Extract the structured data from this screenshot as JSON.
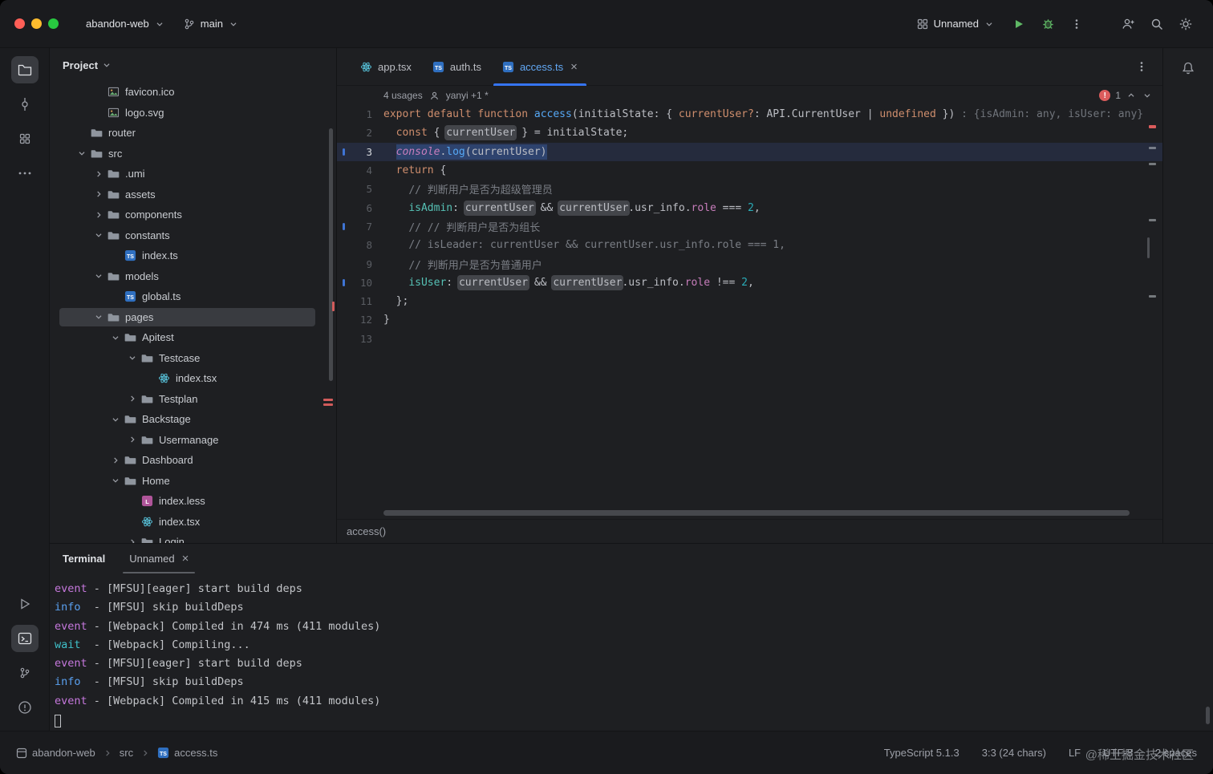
{
  "titlebar": {
    "project": "abandon-web",
    "branch": "main",
    "run_config": "Unnamed",
    "actions": [
      {
        "id": "run",
        "icon": "play"
      },
      {
        "id": "debug",
        "icon": "bug"
      },
      {
        "id": "more",
        "icon": "kebab"
      }
    ],
    "tools": [
      {
        "id": "add-user",
        "icon": "person-plus"
      },
      {
        "id": "search",
        "icon": "search"
      },
      {
        "id": "settings",
        "icon": "gear"
      }
    ]
  },
  "left_rail": {
    "top": [
      {
        "id": "project",
        "icon": "folder-outline",
        "active": true
      },
      {
        "id": "commit",
        "icon": "commit",
        "active": false
      },
      {
        "id": "structure",
        "icon": "grid",
        "active": false
      },
      {
        "id": "more",
        "icon": "more-dots",
        "active": false
      }
    ],
    "bottom": [
      {
        "id": "run",
        "icon": "run-outline",
        "active": false
      },
      {
        "id": "terminal",
        "icon": "terminal",
        "active": true
      },
      {
        "id": "version-control",
        "icon": "branch",
        "active": false
      },
      {
        "id": "problems",
        "icon": "problems",
        "active": false
      }
    ]
  },
  "project_panel": {
    "title": "Project",
    "tree": [
      {
        "label": "favicon.ico",
        "depth": 2,
        "icon": "image"
      },
      {
        "label": "logo.svg",
        "depth": 2,
        "icon": "image"
      },
      {
        "label": "router",
        "depth": 1,
        "icon": "folder"
      },
      {
        "label": "src",
        "depth": 1,
        "icon": "folder",
        "chevron": "down"
      },
      {
        "label": ".umi",
        "depth": 2,
        "icon": "folder",
        "chevron": "right"
      },
      {
        "label": "assets",
        "depth": 2,
        "icon": "folder",
        "chevron": "right"
      },
      {
        "label": "components",
        "depth": 2,
        "icon": "folder",
        "chevron": "right"
      },
      {
        "label": "constants",
        "depth": 2,
        "icon": "folder",
        "chevron": "down"
      },
      {
        "label": "index.ts",
        "depth": 3,
        "icon": "ts"
      },
      {
        "label": "models",
        "depth": 2,
        "icon": "folder",
        "chevron": "down"
      },
      {
        "label": "global.ts",
        "depth": 3,
        "icon": "ts"
      },
      {
        "label": "pages",
        "depth": 2,
        "icon": "folder",
        "chevron": "down",
        "selected": true
      },
      {
        "label": "Apitest",
        "depth": 3,
        "icon": "folder",
        "chevron": "down"
      },
      {
        "label": "Testcase",
        "depth": 4,
        "icon": "folder",
        "chevron": "down"
      },
      {
        "label": "index.tsx",
        "depth": 5,
        "icon": "tsx"
      },
      {
        "label": "Testplan",
        "depth": 4,
        "icon": "folder",
        "chevron": "right"
      },
      {
        "label": "Backstage",
        "depth": 3,
        "icon": "folder",
        "chevron": "down"
      },
      {
        "label": "Usermanage",
        "depth": 4,
        "icon": "folder",
        "chevron": "right"
      },
      {
        "label": "Dashboard",
        "depth": 3,
        "icon": "folder",
        "chevron": "right"
      },
      {
        "label": "Home",
        "depth": 3,
        "icon": "folder",
        "chevron": "down"
      },
      {
        "label": "index.less",
        "depth": 4,
        "icon": "less"
      },
      {
        "label": "index.tsx",
        "depth": 4,
        "icon": "tsx"
      },
      {
        "label": "Login",
        "depth": 4,
        "icon": "folder",
        "chevron": "right"
      }
    ]
  },
  "editor": {
    "tabs": [
      {
        "label": "app.tsx",
        "icon": "tsx",
        "active": false,
        "closable": false
      },
      {
        "label": "auth.ts",
        "icon": "ts",
        "active": false,
        "closable": false
      },
      {
        "label": "access.ts",
        "icon": "ts",
        "active": true,
        "closable": true
      }
    ],
    "usages_label": "4 usages",
    "author": "yanyi +1 *",
    "error_badge": "1",
    "breadcrumb": "access()",
    "code": {
      "lines": [
        {
          "num": "1",
          "tokens": [
            {
              "t": "export",
              "c": "kw"
            },
            {
              "t": " "
            },
            {
              "t": "default",
              "c": "kw"
            },
            {
              "t": " "
            },
            {
              "t": "function",
              "c": "kw"
            },
            {
              "t": " "
            },
            {
              "t": "access",
              "c": "fn"
            },
            {
              "t": "(initialState: { "
            },
            {
              "t": "currentUser?",
              "c": "kw"
            },
            {
              "t": ": API.CurrentUser | "
            },
            {
              "t": "undefined",
              "c": "kw"
            },
            {
              "t": " }) "
            },
            {
              "t": ": {isAdmin: any, isUser: any}",
              "c": "hint"
            }
          ]
        },
        {
          "num": "2",
          "tokens": [
            {
              "t": "  "
            },
            {
              "t": "const",
              "c": "kw"
            },
            {
              "t": " { "
            },
            {
              "t": "currentUser",
              "hl": true
            },
            {
              "t": " } = initialState;"
            }
          ]
        },
        {
          "num": "3",
          "caret": true,
          "changed": true,
          "tokens": [
            {
              "t": "  "
            },
            {
              "t": "console",
              "c": "console",
              "sel": true
            },
            {
              "t": ".",
              "sel": true
            },
            {
              "t": "log",
              "c": "fn",
              "sel": true
            },
            {
              "t": "(currentUser)",
              "sel": true
            }
          ]
        },
        {
          "num": "4",
          "tokens": [
            {
              "t": "  "
            },
            {
              "t": "return",
              "c": "kw"
            },
            {
              "t": " {"
            }
          ]
        },
        {
          "num": "5",
          "tokens": [
            {
              "t": "    "
            },
            {
              "t": "// 判断用户是否为超级管理员",
              "c": "cmt"
            }
          ]
        },
        {
          "num": "6",
          "tokens": [
            {
              "t": "    "
            },
            {
              "t": "isAdmin",
              "c": "key"
            },
            {
              "t": ": "
            },
            {
              "t": "currentUser",
              "hl": true
            },
            {
              "t": " && "
            },
            {
              "t": "currentUser",
              "hl": true
            },
            {
              "t": ".usr_info."
            },
            {
              "t": "role",
              "c": "prop"
            },
            {
              "t": " === "
            },
            {
              "t": "2",
              "c": "num"
            },
            {
              "t": ","
            }
          ]
        },
        {
          "num": "7",
          "changed": true,
          "tokens": [
            {
              "t": "    "
            },
            {
              "t": "// // 判断用户是否为组长",
              "c": "cmt"
            }
          ]
        },
        {
          "num": "8",
          "tokens": [
            {
              "t": "    "
            },
            {
              "t": "// isLeader: currentUser && currentUser.usr_info.role === 1,",
              "c": "cmt"
            }
          ]
        },
        {
          "num": "9",
          "tokens": [
            {
              "t": "    "
            },
            {
              "t": "// 判断用户是否为普通用户",
              "c": "cmt"
            }
          ]
        },
        {
          "num": "10",
          "changed": true,
          "tokens": [
            {
              "t": "    "
            },
            {
              "t": "isUser",
              "c": "key"
            },
            {
              "t": ": "
            },
            {
              "t": "currentUser",
              "hl": true
            },
            {
              "t": " && "
            },
            {
              "t": "currentUser",
              "hl": true
            },
            {
              "t": ".usr_info."
            },
            {
              "t": "role",
              "c": "prop"
            },
            {
              "t": " !== "
            },
            {
              "t": "2",
              "c": "num"
            },
            {
              "t": ","
            }
          ]
        },
        {
          "num": "11",
          "tokens": [
            {
              "t": "  };"
            }
          ]
        },
        {
          "num": "12",
          "tokens": [
            {
              "t": "}"
            }
          ]
        },
        {
          "num": "13",
          "tokens": []
        }
      ]
    }
  },
  "terminal": {
    "title": "Terminal",
    "tab": "Unnamed",
    "level_colors": {
      "event": "#c678dd",
      "info": "#5aa0f0",
      "wait": "#3fc0c9"
    },
    "lines": [
      {
        "level": "event",
        "text": "- [MFSU][eager] start build deps"
      },
      {
        "level": "info",
        "text": "- [MFSU] skip buildDeps"
      },
      {
        "level": "event",
        "text": "- [Webpack] Compiled in 474 ms (411 modules)"
      },
      {
        "level": "wait",
        "text": "- [Webpack] Compiling..."
      },
      {
        "level": "event",
        "text": "- [MFSU][eager] start build deps"
      },
      {
        "level": "info",
        "text": "- [MFSU] skip buildDeps"
      },
      {
        "level": "event",
        "text": "- [Webpack] Compiled in 415 ms (411 modules)"
      }
    ]
  },
  "status_bar": {
    "left": [
      {
        "label": "abandon-web",
        "icon": "window"
      },
      {
        "label": "src"
      },
      {
        "label": "access.ts",
        "icon": "ts"
      }
    ],
    "right": [
      "TypeScript 5.1.3",
      "3:3 (24 chars)",
      "LF",
      "UTF-8",
      "2 spaces"
    ],
    "watermark": "@稀土掘金技术社区"
  },
  "colors": {
    "accent": "#3574f0",
    "selection": "#2e436e",
    "caret_line": "#252b3d",
    "usage_highlight": "#43454a",
    "error": "#db5c5c",
    "run_green": "#5fb865",
    "keyword": "#cf8e6d",
    "function_name": "#56a8f5",
    "object_key": "#56c1b5",
    "property": "#c77dbb",
    "number": "#2aacb8",
    "comment": "#7a7e85",
    "hint": "#70747b",
    "text": "#bcbec4",
    "modified_file": "#62a8f5"
  }
}
